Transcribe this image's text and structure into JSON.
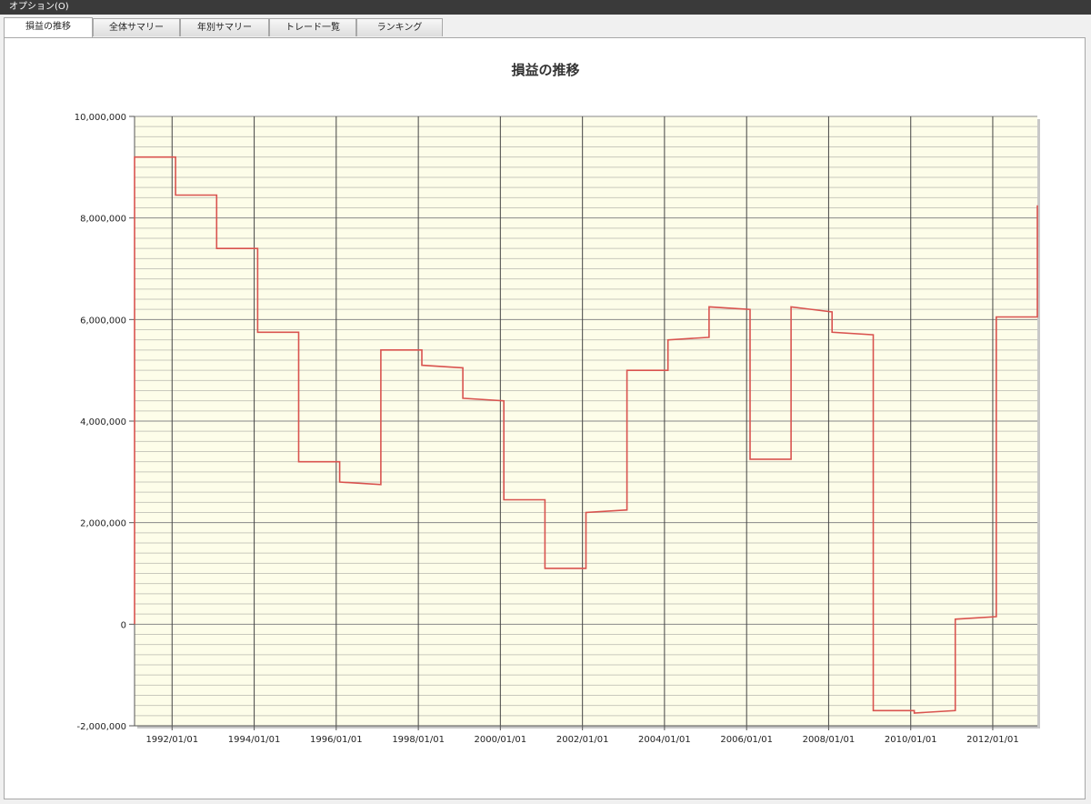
{
  "menu": {
    "option_label": "オプション(O)"
  },
  "tabs": [
    {
      "label": "損益の推移",
      "active": true
    },
    {
      "label": "全体サマリー",
      "active": false
    },
    {
      "label": "年別サマリー",
      "active": false
    },
    {
      "label": "トレード一覧",
      "active": false
    },
    {
      "label": "ランキング",
      "active": false
    }
  ],
  "colors": {
    "plot_background": "#fdfde9",
    "line": "#d9534f",
    "grid": "#9a9a9a",
    "major_grid": "#444444"
  },
  "chart_data": {
    "type": "line",
    "title": "損益の推移",
    "xlabel": "",
    "ylabel": "",
    "x_range": [
      "1991/02/01",
      "2013/02/01"
    ],
    "ylim": [
      -2000000,
      10000000
    ],
    "y_ticks": [
      -2000000,
      0,
      2000000,
      4000000,
      6000000,
      8000000,
      10000000
    ],
    "y_tick_labels": [
      "-2,000,000",
      "0",
      "2,000,000",
      "4,000,000",
      "6,000,000",
      "8,000,000",
      "10,000,000"
    ],
    "x_ticks": [
      "1992/01/01",
      "1994/01/01",
      "1996/01/01",
      "1998/01/01",
      "2000/01/01",
      "2002/01/01",
      "2004/01/01",
      "2006/01/01",
      "2008/01/01",
      "2010/01/01",
      "2012/01/01"
    ],
    "x_tick_labels": [
      "1992/01/01",
      "1994/01/01",
      "1996/01/01",
      "1998/01/01",
      "2000/01/01",
      "2002/01/01",
      "2004/01/01",
      "2006/01/01",
      "2008/01/01",
      "2010/01/01",
      "2012/01/01"
    ],
    "grid": true,
    "legend": "none",
    "series": [
      {
        "x": [
          "1991/02/01",
          "1991/02/01",
          "1992/02/01",
          "1992/02/01",
          "1993/02/01",
          "1993/02/01",
          "1994/02/01",
          "1994/02/01",
          "1995/02/01",
          "1995/02/01",
          "1996/02/01",
          "1996/02/01",
          "1997/02/01",
          "1997/02/01",
          "1998/02/01",
          "1998/02/01",
          "1999/02/01",
          "1999/02/01",
          "2000/02/01",
          "2000/02/01",
          "2001/02/01",
          "2001/02/01",
          "2002/02/01",
          "2002/02/01",
          "2003/02/01",
          "2003/02/01",
          "2004/02/01",
          "2004/02/01",
          "2005/02/01",
          "2005/02/01",
          "2006/02/01",
          "2006/02/01",
          "2007/02/01",
          "2007/02/01",
          "2008/02/01",
          "2008/02/01",
          "2009/02/01",
          "2009/02/01",
          "2010/02/01",
          "2010/02/01",
          "2011/02/01",
          "2011/02/01",
          "2012/02/01",
          "2012/02/01",
          "2013/02/01",
          "2013/02/01"
        ],
        "y": [
          0,
          9200000,
          9200000,
          8450000,
          8450000,
          7400000,
          7400000,
          5750000,
          5750000,
          3200000,
          3200000,
          2800000,
          2750000,
          5400000,
          5400000,
          5100000,
          5050000,
          4450000,
          4400000,
          2450000,
          2450000,
          1100000,
          1100000,
          2200000,
          2250000,
          5000000,
          5000000,
          5600000,
          5650000,
          6250000,
          6200000,
          3250000,
          3250000,
          6250000,
          6150000,
          5750000,
          5700000,
          -1700000,
          -1700000,
          -1750000,
          -1700000,
          100000,
          150000,
          6050000,
          6050000,
          8250000
        ]
      }
    ]
  }
}
